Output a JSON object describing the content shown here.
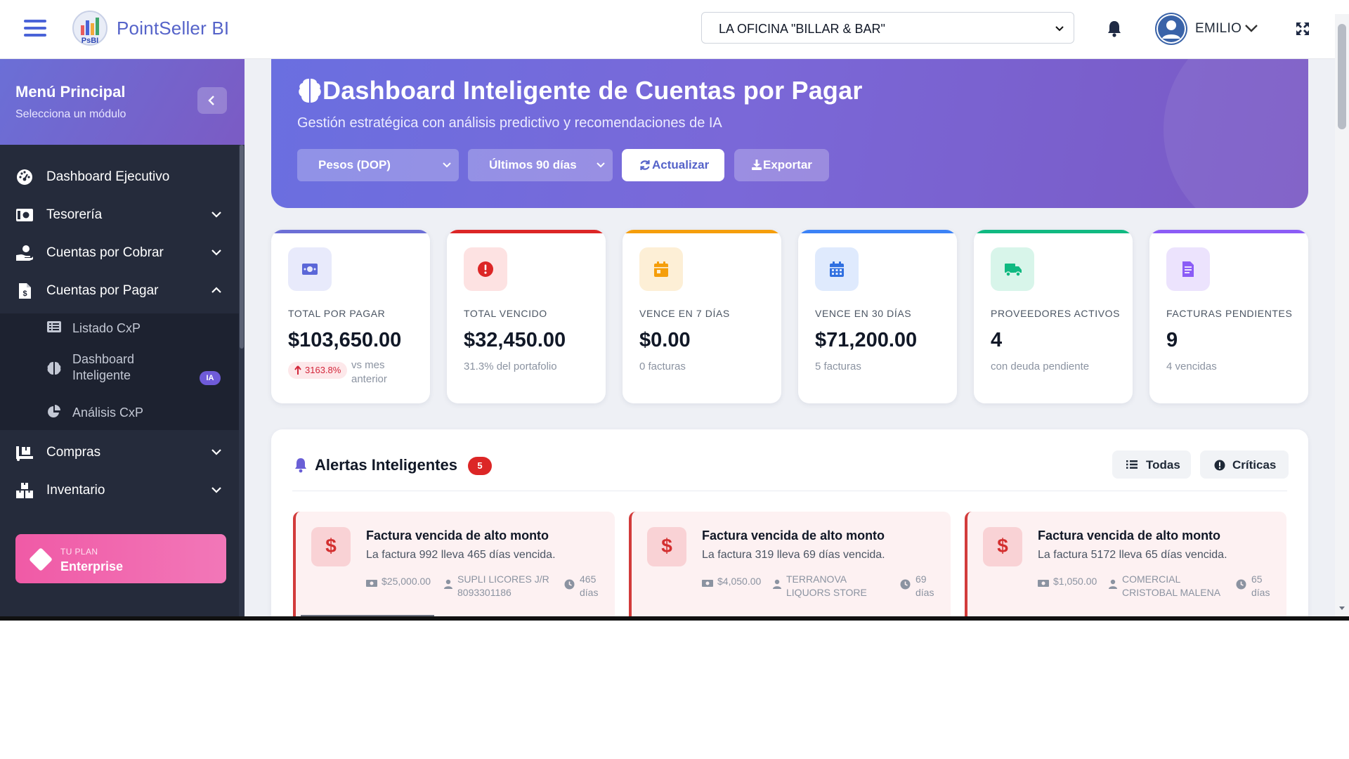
{
  "app": {
    "brand": "PointSeller BI",
    "logo_text": "PsBI",
    "company": "LA OFICINA \"BILLAR & BAR\"",
    "user": "EMILIO"
  },
  "sidebar": {
    "title": "Menú Principal",
    "subtitle": "Selecciona un módulo",
    "items": [
      {
        "label": "Dashboard Ejecutivo",
        "icon": "gauge-icon",
        "expandable": false
      },
      {
        "label": "Tesorería",
        "icon": "money-bill-icon",
        "expandable": true,
        "expanded": false
      },
      {
        "label": "Cuentas por Cobrar",
        "icon": "hand-money-icon",
        "expandable": true,
        "expanded": false
      },
      {
        "label": "Cuentas por Pagar",
        "icon": "invoice-dollar-icon",
        "expandable": true,
        "expanded": true
      },
      {
        "label": "Compras",
        "icon": "truck-loading-icon",
        "expandable": true,
        "expanded": false
      },
      {
        "label": "Inventario",
        "icon": "boxes-icon",
        "expandable": true,
        "expanded": false
      }
    ],
    "subitems": [
      {
        "label": "Listado CxP",
        "icon": "list-icon"
      },
      {
        "label": "Dashboard Inteligente",
        "label_line1": "Dashboard",
        "label_line2": "Inteligente",
        "icon": "brain-icon",
        "badge": "IA",
        "active": true
      },
      {
        "label": "Análisis CxP",
        "icon": "chart-pie-icon"
      }
    ],
    "plan": {
      "kicker": "TU PLAN",
      "name": "Enterprise"
    }
  },
  "hero": {
    "title": "Dashboard Inteligente de Cuentas por Pagar",
    "subtitle": "Gestión estratégica con análisis predictivo y recomendaciones de IA",
    "currency": "Pesos (DOP)",
    "period": "Últimos 90 días",
    "refresh_label": "Actualizar",
    "export_label": "Exportar"
  },
  "kpis": [
    {
      "label": "TOTAL POR PAGAR",
      "value": "$103,650.00",
      "trend": "3163.8%",
      "trend_note": "vs mes anterior",
      "color": "#6c6fd6",
      "icon": "money-bill-icon"
    },
    {
      "label": "TOTAL VENCIDO",
      "value": "$32,450.00",
      "sub": "31.3% del portafolio",
      "color": "#dc2626",
      "icon": "exclamation-circle-icon"
    },
    {
      "label": "VENCE EN 7 DÍAS",
      "value": "$0.00",
      "sub": "0 facturas",
      "color": "#f59e0b",
      "icon": "calendar-day-icon"
    },
    {
      "label": "VENCE EN 30 DÍAS",
      "value": "$71,200.00",
      "sub": "5 facturas",
      "color": "#3b82f6",
      "icon": "calendar-icon"
    },
    {
      "label": "PROVEEDORES ACTIVOS",
      "value": "4",
      "sub": "con deuda pendiente",
      "color": "#10b981",
      "icon": "truck-icon"
    },
    {
      "label": "FACTURAS PENDIENTES",
      "value": "9",
      "sub": "4 vencidas",
      "color": "#8b5cf6",
      "icon": "file-invoice-icon"
    }
  ],
  "alerts": {
    "title": "Alertas Inteligentes",
    "count": "5",
    "filters": [
      "Todas",
      "Críticas"
    ],
    "items": [
      {
        "title": "Factura vencida de alto monto",
        "desc": "La factura 992 lleva 465 días vencida.",
        "amount": "$25,000.00",
        "supplier_l1": "SUPLI LICORES J/R",
        "supplier_l2": "8093301186",
        "days_l1": "465",
        "days_l2": "días"
      },
      {
        "title": "Factura vencida de alto monto",
        "desc": "La factura 319 lleva 69 días vencida.",
        "amount": "$4,050.00",
        "supplier_l1": "TERRANOVA",
        "supplier_l2": "LIQUORS STORE",
        "days_l1": "69",
        "days_l2": "días"
      },
      {
        "title": "Factura vencida de alto monto",
        "desc": "La factura 5172 lleva 65 días vencida.",
        "amount": "$1,050.00",
        "supplier_l1": "COMERCIAL",
        "supplier_l2": "CRISTOBAL MALENA",
        "days_l1": "65",
        "days_l2": "días"
      }
    ]
  },
  "colors": {
    "accent": "#5563c9",
    "sidebar": "#252b3b",
    "danger": "#dc2626"
  }
}
